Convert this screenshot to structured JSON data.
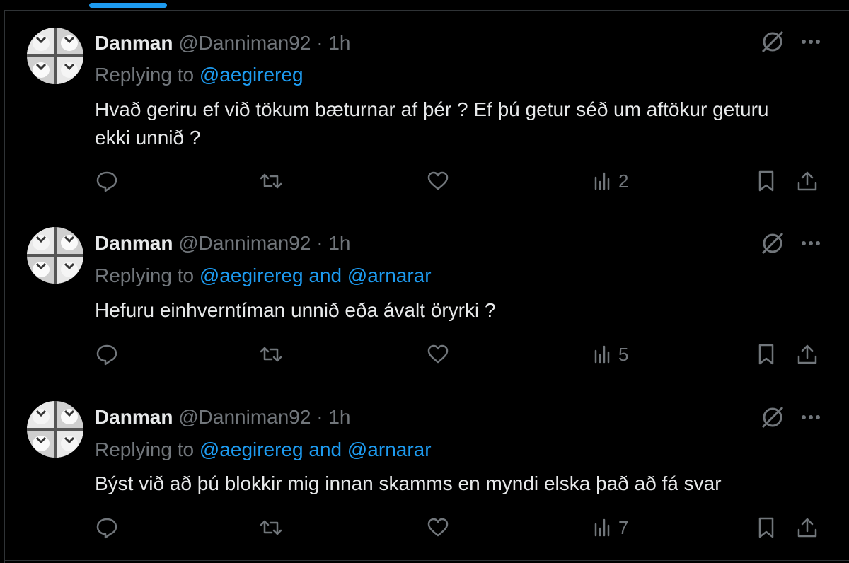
{
  "tweets": [
    {
      "author": "Danman",
      "handle": "@Danniman92",
      "separator": "·",
      "time": "1h",
      "replying_prefix": "Replying to",
      "replying_to": "@aegirereg",
      "text": "Hvað geriru ef við tökum bæturnar af þér ? Ef þú getur séð um aftökur geturu ekki unnið ?",
      "views": "2"
    },
    {
      "author": "Danman",
      "handle": "@Danniman92",
      "separator": "·",
      "time": "1h",
      "replying_prefix": "Replying to",
      "replying_to": "@aegirereg and @arnarar",
      "text": "Hefuru einhverntíman unnið eða ávalt öryrki ?",
      "views": "5"
    },
    {
      "author": "Danman",
      "handle": "@Danniman92",
      "separator": "·",
      "time": "1h",
      "replying_prefix": "Replying to",
      "replying_to": "@aegirereg and @arnarar",
      "text": "Býst við að þú blokkir mig innan skamms en myndi elska það að fá svar",
      "views": "7"
    }
  ],
  "colors": {
    "background": "#000000",
    "text": "#e7e9ea",
    "muted": "#71767b",
    "accent": "#1d9bf0",
    "border": "#2f3336"
  },
  "icons": [
    "avatar",
    "grok-icon",
    "more-icon",
    "reply-icon",
    "retweet-icon",
    "like-icon",
    "views-icon",
    "bookmark-icon",
    "share-icon"
  ]
}
